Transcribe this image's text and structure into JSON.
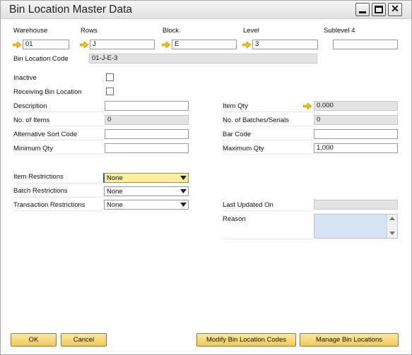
{
  "window": {
    "title": "Bin Location Master Data"
  },
  "location": {
    "warehouse_label": "Warehouse",
    "warehouse_value": "01",
    "rows_label": "Rows",
    "rows_value": "J",
    "block_label": "Block",
    "block_value": "E",
    "level_label": "Level",
    "level_value": "3",
    "sublevel4_label": "Sublevel 4",
    "sublevel4_value": "",
    "bin_code_label": "Bin Location Code",
    "bin_code_value": "01-J-E-3"
  },
  "flags": {
    "inactive_label": "Inactive",
    "inactive_checked": false,
    "receiving_label": "Receiving Bin Location",
    "receiving_checked": false
  },
  "left": {
    "description_label": "Description",
    "description_value": "",
    "no_items_label": "No. of Items",
    "no_items_value": "0",
    "alt_sort_label": "Alternative Sort Code",
    "alt_sort_value": "",
    "min_qty_label": "Minimum Qty",
    "min_qty_value": ""
  },
  "right": {
    "item_qty_label": "Item Qty",
    "item_qty_value": "0.000",
    "batches_label": "No. of Batches/Serials",
    "batches_value": "0",
    "bar_code_label": "Bar Code",
    "bar_code_value": "",
    "max_qty_label": "Maximum Qty",
    "max_qty_value": "1,000"
  },
  "restrictions": {
    "item_label": "Item Restrictions",
    "item_value": "None",
    "batch_label": "Batch Restrictions",
    "batch_value": "None",
    "transaction_label": "Transaction Restrictions",
    "transaction_value": "None"
  },
  "audit": {
    "last_updated_label": "Last Updated On",
    "last_updated_value": "",
    "reason_label": "Reason",
    "reason_value": ""
  },
  "buttons": {
    "ok": "OK",
    "cancel": "Cancel",
    "modify": "Modify Bin Location Codes",
    "manage": "Manage Bin Locations"
  },
  "colors": {
    "button_gold": "#f3c95a",
    "active_field_yellow": "#fbeea0",
    "link_arrow": "#f2c300"
  },
  "icons": [
    "link-arrow-icon",
    "dropdown-arrow-icon",
    "scroll-up-icon",
    "scroll-down-icon",
    "minimize-icon",
    "maximize-icon",
    "close-icon"
  ]
}
